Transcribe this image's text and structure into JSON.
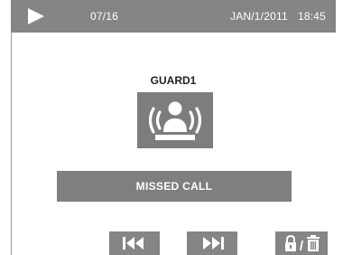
{
  "header": {
    "play_icon": "play-icon",
    "counter": "07/16",
    "date": "JAN/1/2011",
    "time": "18:45"
  },
  "record": {
    "caller_name": "GUARD1",
    "caller_icon": "guard-alarm-icon",
    "status": "MISSED CALL"
  },
  "controls": {
    "previous_icon": "skip-previous-icon",
    "next_icon": "skip-next-icon",
    "lock_delete_icon": "lock-delete-icon",
    "lock_delete_separator": "/"
  },
  "colors": {
    "bar_gray": "#858585",
    "icon_fill": "#ffffff",
    "text_dark": "#222222"
  }
}
